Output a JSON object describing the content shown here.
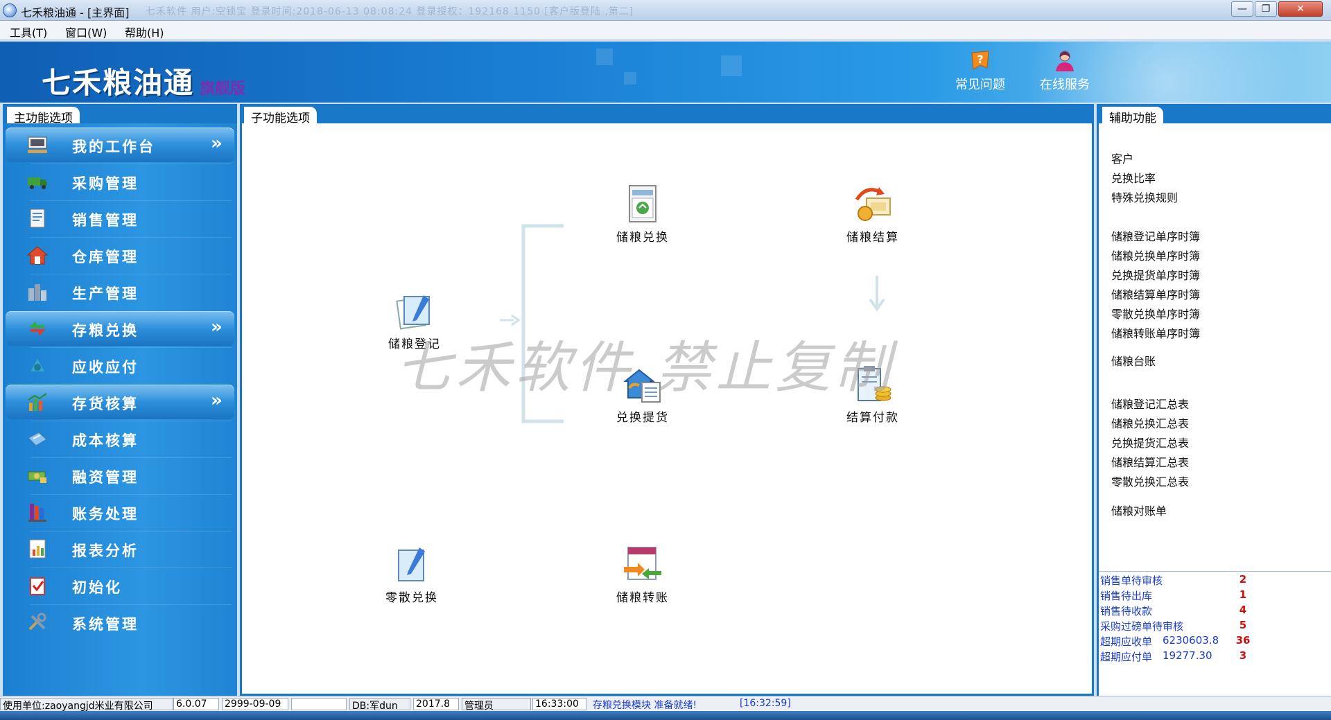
{
  "window": {
    "title": "七禾粮油通 - [主界面]",
    "faded_info": "七禾软件 用户:空锁宝 登录时间:2018-06-13 08:08:24 登录授权：192168 1150 [客户版登陆 ,第二]",
    "min_glyph": "—",
    "max_glyph": "❐",
    "close_glyph": "✕"
  },
  "menu": [
    "工具(T)",
    "窗口(W)",
    "帮助(H)"
  ],
  "banner": {
    "brand": "七禾粮油通",
    "edition": "旗舰版",
    "buttons": [
      {
        "label": "常见问题",
        "icon": "faq-icon"
      },
      {
        "label": "在线服务",
        "icon": "support-person-icon"
      }
    ]
  },
  "left_panel": {
    "title": "主功能选项",
    "items": [
      {
        "label": "我的工作台",
        "icon": "workbench-icon",
        "expanded": true
      },
      {
        "label": "采购管理",
        "icon": "truck-icon"
      },
      {
        "label": "销售管理",
        "icon": "document-icon"
      },
      {
        "label": "仓库管理",
        "icon": "house-icon"
      },
      {
        "label": "生产管理",
        "icon": "factory-icon"
      },
      {
        "label": "存粮兑换",
        "icon": "exchange-arrows-icon",
        "expanded": true
      },
      {
        "label": "应收应付",
        "icon": "money-icon"
      },
      {
        "label": "存货核算",
        "icon": "bar-chart-icon",
        "expanded": true
      },
      {
        "label": "成本核算",
        "icon": "calculator-icon"
      },
      {
        "label": "融资管理",
        "icon": "cash-icon"
      },
      {
        "label": "账务处理",
        "icon": "ledger-icon"
      },
      {
        "label": "报表分析",
        "icon": "report-icon"
      },
      {
        "label": "初始化",
        "icon": "clipboard-check-icon"
      },
      {
        "label": "系统管理",
        "icon": "tools-icon"
      }
    ],
    "chevron": "»"
  },
  "center_panel": {
    "title": "子功能选项",
    "watermark": "七禾软件 禁止复制",
    "functions": [
      {
        "id": "register",
        "label": "储粮登记"
      },
      {
        "id": "exchange",
        "label": "储粮兑换"
      },
      {
        "id": "settle",
        "label": "储粮结算"
      },
      {
        "id": "pickup",
        "label": "兑换提货"
      },
      {
        "id": "payment",
        "label": "结算付款"
      },
      {
        "id": "retail",
        "label": "零散兑换"
      },
      {
        "id": "transfer",
        "label": "储粮转账"
      }
    ]
  },
  "right_panel": {
    "title": "辅助功能",
    "links": [
      "客户",
      "兑换比率",
      "特殊兑换规则",
      "储粮登记单序时簿",
      "储粮兑换单序时簿",
      "兑换提货单序时簿",
      "储粮结算单序时簿",
      "零散兑换单序时簿",
      "储粮转账单序时簿",
      "储粮台账",
      "储粮登记汇总表",
      "储粮兑换汇总表",
      "兑换提货汇总表",
      "储粮结算汇总表",
      "零散兑换汇总表",
      "储粮对账单"
    ],
    "stats": [
      {
        "name": "销售单待审核",
        "value": "",
        "count": "2"
      },
      {
        "name": "销售待出库",
        "value": "",
        "count": "1"
      },
      {
        "name": "销售待收款",
        "value": "",
        "count": "4"
      },
      {
        "name": "采购过磅单待审核",
        "value": "",
        "count": "5"
      },
      {
        "name": "超期应收单",
        "value": "6230603.8",
        "count": "36"
      },
      {
        "name": "超期应付单",
        "value": "19277.30",
        "count": "3"
      }
    ]
  },
  "statusbar": {
    "unit": "使用单位:zaoyangjd米业有限公司",
    "version": "6.0.07",
    "expiry": "2999-09-09",
    "blank": "",
    "db": "DB:军dun",
    "period": "2017.8",
    "role": "管理员",
    "time": "16:33:00",
    "message": "存粮兑换模块 准备就绪!",
    "msg_time": "[16:32:59]"
  },
  "colors": {
    "accent": "#1a78c8",
    "stat_text": "#1a3ccf",
    "stat_count": "#d01010"
  }
}
